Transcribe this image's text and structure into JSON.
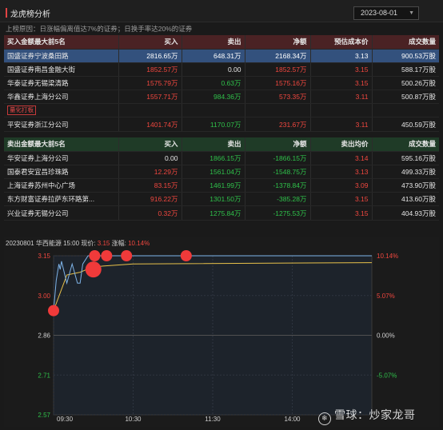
{
  "header": {
    "title": "龙虎榜分析",
    "date": "2023-08-01"
  },
  "reason": "上榜原因：日涨幅偏离值达7%的证券；日换手率达20%的证券",
  "buy_table": {
    "columns": [
      "买入金额最大前5名",
      "买入",
      "卖出",
      "净额",
      "预估成本价",
      "成交数量"
    ],
    "rows": [
      [
        "国盛证券宁波桑田路",
        "2816.65万",
        "648.31万",
        "2168.34万",
        "3.13",
        "900.53万股"
      ],
      [
        "国盛证券南昌金融大街",
        "1852.57万",
        "0.00",
        "1852.57万",
        "3.15",
        "588.17万股"
      ],
      [
        "华泰证券无锡梁清路",
        "1575.79万",
        "0.63万",
        "1575.16万",
        "3.15",
        "500.26万股"
      ],
      [
        "华鑫证券上海分公司",
        "1557.71万",
        "984.36万",
        "573.35万",
        "3.11",
        "500.87万股"
      ],
      [
        "平安证券浙江分公司",
        "1401.74万",
        "1170.07万",
        "231.67万",
        "3.11",
        "450.59万股"
      ]
    ],
    "tag": "量化打板"
  },
  "sell_table": {
    "columns": [
      "卖出金额最大前5名",
      "买入",
      "卖出",
      "净额",
      "卖出均价",
      "成交数量"
    ],
    "rows": [
      [
        "华安证券上海分公司",
        "0.00",
        "1866.15万",
        "-1866.15万",
        "3.14",
        "595.16万股"
      ],
      [
        "国泰君安宜昌珍珠路",
        "12.29万",
        "1561.04万",
        "-1548.75万",
        "3.13",
        "499.33万股"
      ],
      [
        "上海证券苏州中心广场",
        "83.15万",
        "1461.99万",
        "-1378.84万",
        "3.09",
        "473.90万股"
      ],
      [
        "东方财富证券拉萨东环路第...",
        "916.22万",
        "1301.50万",
        "-385.28万",
        "3.15",
        "413.60万股"
      ],
      [
        "兴业证券无锡分公司",
        "0.32万",
        "1275.84万",
        "-1275.53万",
        "3.15",
        "404.93万股"
      ]
    ]
  },
  "chart_info": {
    "date": "20230801",
    "name": "华西能源",
    "time": "15:00",
    "price_label": "现价:",
    "price": "3.15",
    "chg_label": "涨幅:",
    "chg": "10.14%"
  },
  "chart_data": {
    "type": "line",
    "title": "",
    "xlabel": "",
    "ylabel": "",
    "ylim": [
      2.57,
      3.15
    ],
    "yticks": [
      "3.15",
      "3.00",
      "2.86",
      "2.71",
      "2.57"
    ],
    "pct_ticks": [
      "10.14%",
      "5.07%",
      "0.00%",
      "-5.07%"
    ],
    "xticks": [
      "09:30",
      "10:30",
      "11:30",
      "14:00"
    ],
    "series": [
      {
        "name": "",
        "x": [
          0,
          2,
          4,
          5,
          6,
          8,
          10,
          14,
          18,
          20,
          22,
          26,
          28,
          30,
          240
        ],
        "y": [
          2.95,
          3.06,
          3.12,
          3.1,
          3.13,
          3.09,
          3.05,
          3.12,
          3.05,
          3.05,
          3.12,
          3.15,
          3.15,
          3.15,
          3.15
        ]
      },
      {
        "name": "",
        "x": [
          0,
          10,
          20,
          30,
          60,
          240
        ],
        "y": [
          2.95,
          3.08,
          3.09,
          3.11,
          3.12,
          3.125
        ]
      }
    ],
    "markers": [
      {
        "x": 0,
        "y": 2.95,
        "size": 7
      },
      {
        "x": 30,
        "y": 3.1,
        "size": 10
      },
      {
        "x": 31,
        "y": 3.15,
        "size": 7
      },
      {
        "x": 40,
        "y": 3.15,
        "size": 7
      },
      {
        "x": 55,
        "y": 3.15,
        "size": 7
      },
      {
        "x": 100,
        "y": 3.15,
        "size": 7
      }
    ],
    "colors": {
      "price": "#7fb4e8",
      "avg": "#e8c14a",
      "marker": "#f03a3a"
    }
  },
  "watermark": "雪球：炒家龙哥"
}
